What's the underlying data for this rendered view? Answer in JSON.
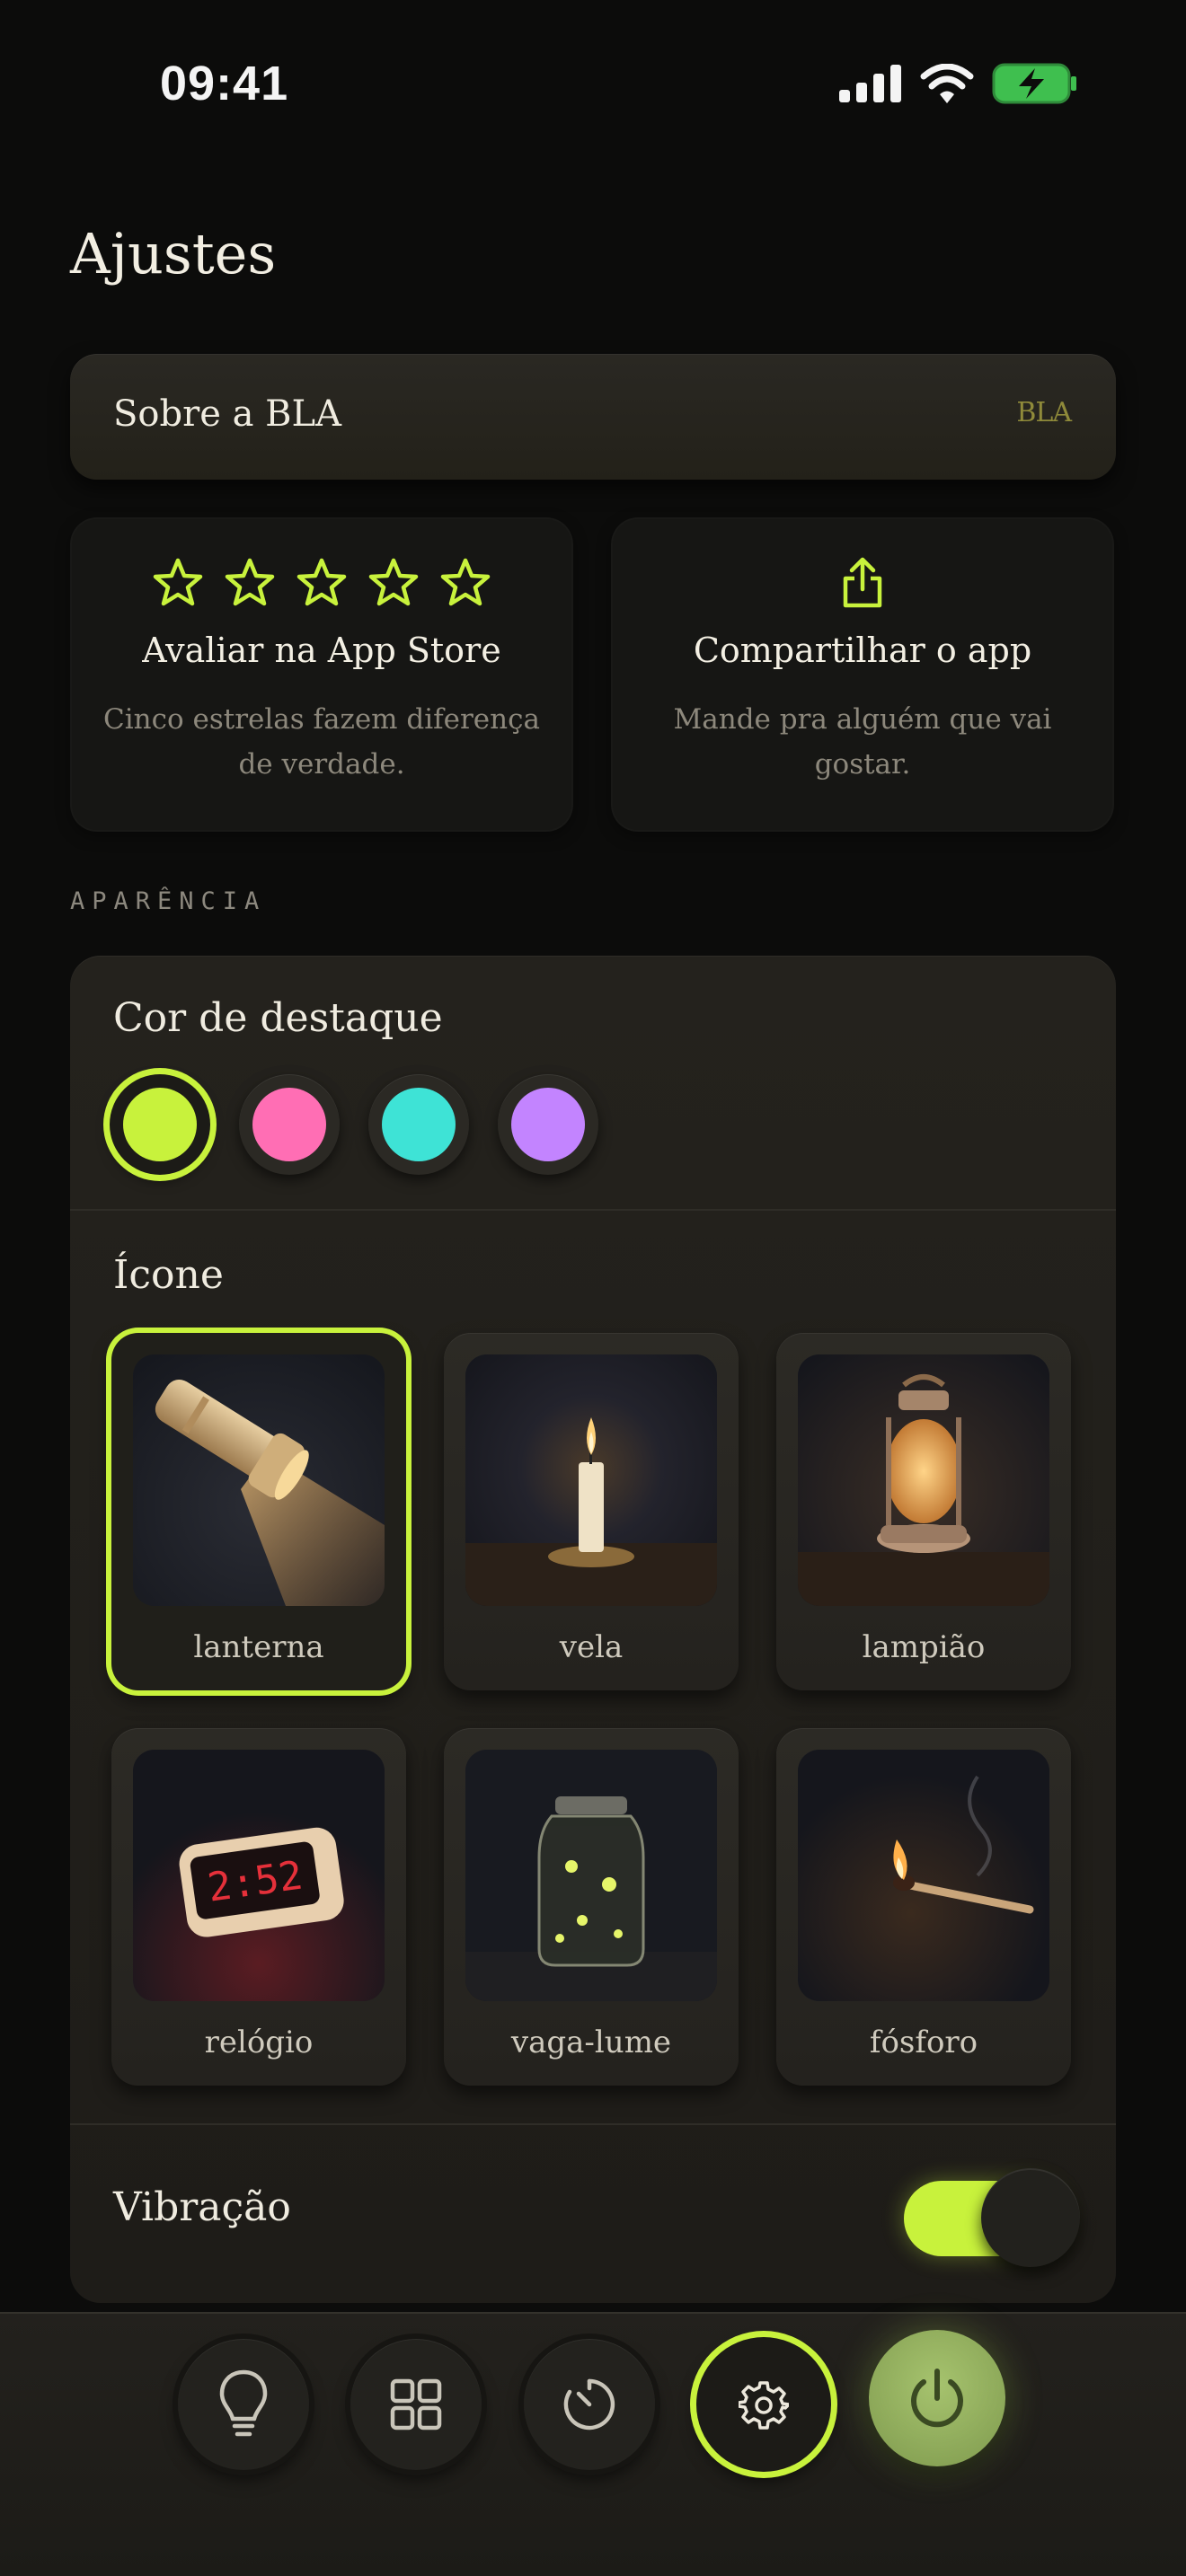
{
  "status_bar": {
    "time": "09:41"
  },
  "page": {
    "title": "Ajustes"
  },
  "about": {
    "label": "Sobre a BLA",
    "logo": "BLA"
  },
  "actions": {
    "rate": {
      "icon": "five-stars-icon",
      "title": "Avaliar na App Store",
      "subtitle": "Cinco estrelas fazem diferença de verdade."
    },
    "share": {
      "icon": "share-icon",
      "title": "Compartilhar o app",
      "subtitle": "Mande pra alguém que vai gostar."
    }
  },
  "appearance": {
    "section_label": "APARÊNCIA",
    "accent": {
      "title": "Cor de destaque",
      "colors": [
        {
          "name": "lime",
          "hex": "#c8f23c",
          "selected": true
        },
        {
          "name": "pink",
          "hex": "#ff6eb4",
          "selected": false
        },
        {
          "name": "cyan",
          "hex": "#3ee3d6",
          "selected": false
        },
        {
          "name": "purple",
          "hex": "#c384ff",
          "selected": false
        }
      ]
    },
    "icon": {
      "title": "Ícone",
      "options": [
        {
          "label": "lanterna",
          "selected": true
        },
        {
          "label": "vela",
          "selected": false
        },
        {
          "label": "lampião",
          "selected": false
        },
        {
          "label": "relógio",
          "selected": false,
          "clock_digits": "2:52"
        },
        {
          "label": "vaga-lume",
          "selected": false
        },
        {
          "label": "fósforo",
          "selected": false
        }
      ]
    },
    "vibration": {
      "label": "Vibração",
      "enabled": true
    }
  },
  "nav": {
    "items": [
      {
        "icon": "lightbulb-icon"
      },
      {
        "icon": "grid-icon"
      },
      {
        "icon": "timer-icon"
      },
      {
        "icon": "gear-icon",
        "active": true
      },
      {
        "icon": "power-icon"
      }
    ]
  },
  "colors": {
    "accent": "#c8f23c",
    "background": "#0c0c0b",
    "card": "#24221d"
  }
}
